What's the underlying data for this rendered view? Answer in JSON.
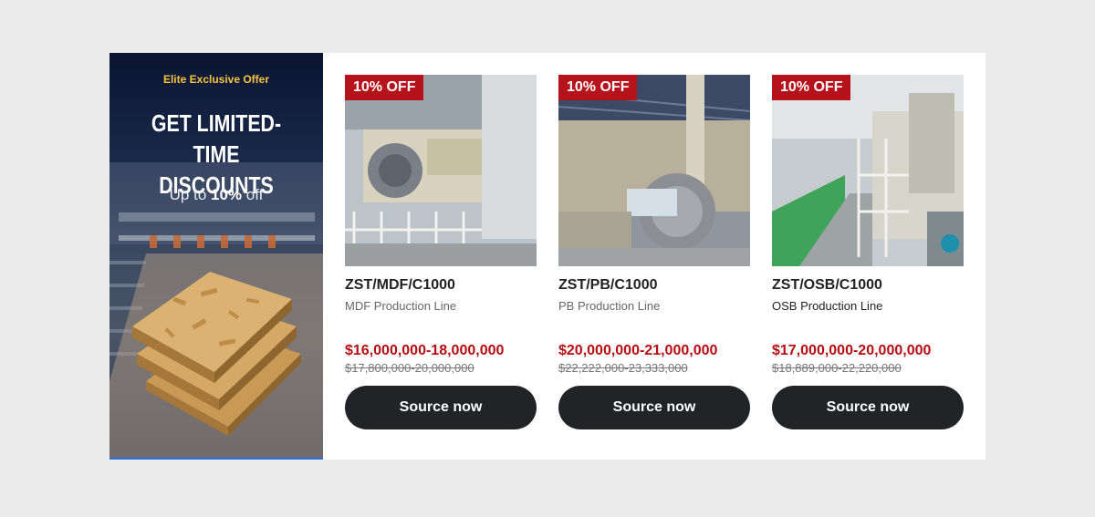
{
  "promo": {
    "eyebrow": "Elite Exclusive Offer",
    "title_line1": "GET LIMITED-TIME",
    "title_line2": "DISCOUNTS",
    "subtitle_prefix": "Up to ",
    "subtitle_value": "10%",
    "subtitle_suffix": " off"
  },
  "products": [
    {
      "badge": "10% OFF",
      "sku": "ZST/MDF/C1000",
      "description": "MDF Production Line",
      "price": "$16,000,000-18,000,000",
      "original_price": "$17,800,000-20,000,000",
      "button_label": "Source now"
    },
    {
      "badge": "10% OFF",
      "sku": "ZST/PB/C1000",
      "description": "PB Production Line",
      "price": "$20,000,000-21,000,000",
      "original_price": "$22,222,000-23,333,000",
      "button_label": "Source now"
    },
    {
      "badge": "10% OFF",
      "sku": "ZST/OSB/C1000",
      "description": "OSB Production Line",
      "price": "$17,000,000-20,000,000",
      "original_price": "$18,889,000-22,220,000",
      "button_label": "Source now"
    }
  ],
  "colors": {
    "badge_bg": "#b5121b",
    "price": "#b50d12",
    "button_bg": "#222327",
    "eyebrow": "#f5c542"
  }
}
